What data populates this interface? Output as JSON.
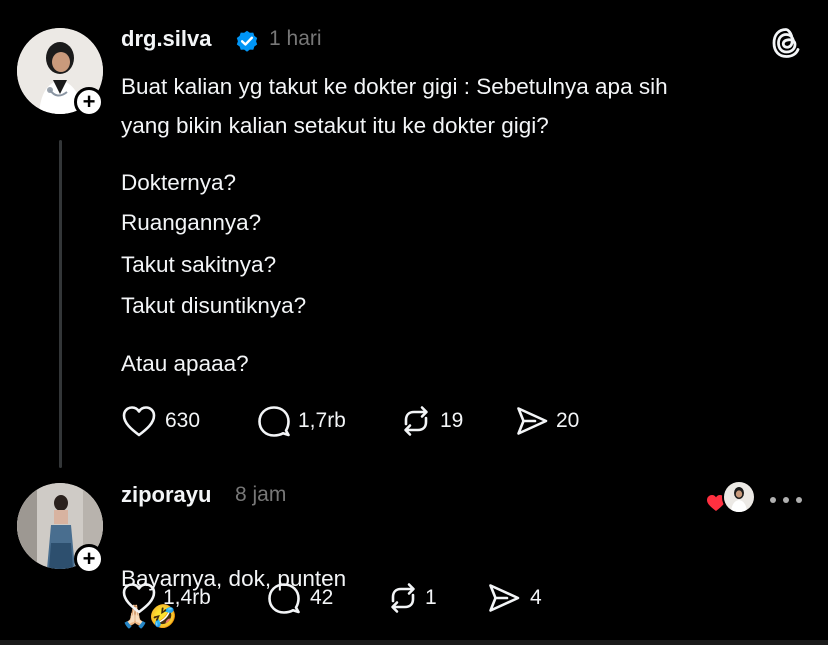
{
  "post": {
    "username": "drg.silva",
    "verified": true,
    "time": "1 hari",
    "lines": {
      "l1": "Buat kalian yg takut ke dokter gigi : Sebetulnya apa sih",
      "l2": "yang bikin kalian setakut itu ke dokter gigi?",
      "l3": "Dokternya?",
      "l4": "Ruangannya?",
      "l5": "Takut sakitnya?",
      "l6": "Takut disuntiknya?",
      "l7": "Atau apaaa?"
    },
    "likes": "630",
    "replies": "1,7rb",
    "reposts": "19",
    "shares": "20"
  },
  "reply": {
    "username": "ziporayu",
    "time": "8 jam",
    "text": "Bayarnya, dok, punten",
    "emoji": "🙏🏻🤣",
    "likes": "1,4rb",
    "replies": "42",
    "reposts": "1",
    "shares": "4"
  },
  "colors": {
    "background": "#000000",
    "text": "#f3f5f7",
    "muted": "#777777",
    "verified": "#0095f6",
    "heart": "#ff3040"
  },
  "icons": [
    "threads-logo-icon",
    "verified-badge-icon",
    "heart-icon",
    "comment-icon",
    "repost-icon",
    "share-icon",
    "more-icon",
    "plus-icon"
  ]
}
